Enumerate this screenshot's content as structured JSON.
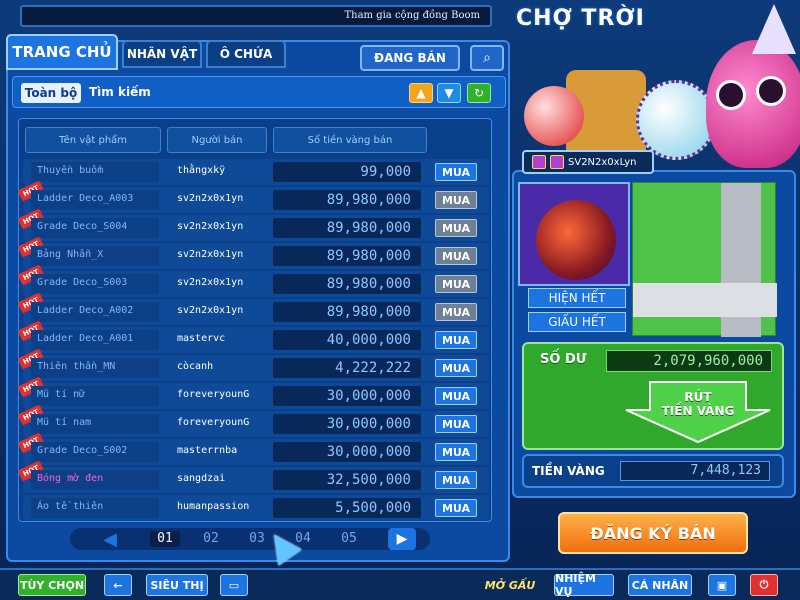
{
  "header": {
    "marquee": "Tham gia cộng đồng Boom",
    "title": "CHỢ TRỜI"
  },
  "tabs": [
    {
      "label": "TRANG CHỦ"
    },
    {
      "label": "NHÂN VẬT"
    },
    {
      "label": "Ô CHỨA"
    }
  ],
  "toolbar": {
    "selling_label": "ĐANG BÁN"
  },
  "filter": {
    "all_label": "Toàn bộ",
    "search_label": "Tìm kiếm"
  },
  "table": {
    "headers": [
      "Tên vật phẩm",
      "Người bán",
      "Số tiền vàng bán"
    ],
    "buy_label": "MUA",
    "hot_label": "HOT",
    "rows": [
      {
        "name": "Thuyền buồm",
        "seller": "thằngxkỹ",
        "price": "99,000",
        "hot": false,
        "pink": false,
        "dim": false
      },
      {
        "name": "Ladder Deco_A003",
        "seller": "sv2n2x0x1yn",
        "price": "89,980,000",
        "hot": true,
        "pink": false,
        "dim": true
      },
      {
        "name": "Grade Deco_S004",
        "seller": "sv2n2x0x1yn",
        "price": "89,980,000",
        "hot": true,
        "pink": false,
        "dim": true
      },
      {
        "name": "Bảng Nhẫn_X",
        "seller": "sv2n2x0x1yn",
        "price": "89,980,000",
        "hot": true,
        "pink": false,
        "dim": true
      },
      {
        "name": "Grade Deco_S003",
        "seller": "sv2n2x0x1yn",
        "price": "89,980,000",
        "hot": true,
        "pink": false,
        "dim": true
      },
      {
        "name": "Ladder Deco_A002",
        "seller": "sv2n2x0x1yn",
        "price": "89,980,000",
        "hot": true,
        "pink": false,
        "dim": true
      },
      {
        "name": "Ladder Deco_A001",
        "seller": "mastervc",
        "price": "40,000,000",
        "hot": true,
        "pink": false,
        "dim": false
      },
      {
        "name": "Thiên thần_MN",
        "seller": "còcanh",
        "price": "4,222,222",
        "hot": true,
        "pink": false,
        "dim": false
      },
      {
        "name": "Mũ tí nữ",
        "seller": "foreveryounG",
        "price": "30,000,000",
        "hot": true,
        "pink": false,
        "dim": false
      },
      {
        "name": "Mũ tí nam",
        "seller": "foreveryounG",
        "price": "30,000,000",
        "hot": true,
        "pink": false,
        "dim": false
      },
      {
        "name": "Grade Deco_S002",
        "seller": "masterrnba",
        "price": "30,000,000",
        "hot": true,
        "pink": false,
        "dim": false
      },
      {
        "name": "Bóng mờ đen",
        "seller": "sangdzai",
        "price": "32,500,000",
        "hot": true,
        "pink": true,
        "dim": false
      },
      {
        "name": "Áo tề thiên",
        "seller": "humanpassion",
        "price": "5,500,000",
        "hot": false,
        "pink": false,
        "dim": false
      }
    ]
  },
  "pager": {
    "pages": [
      "01",
      "02",
      "03",
      "04",
      "05"
    ],
    "active": "01"
  },
  "profile": {
    "name": "SV2N2x0xLyn",
    "show_all": "HIỆN HẾT",
    "hide_all": "GIẤU HẾT",
    "balance_label": "SỐ DƯ",
    "balance": "2,079,960,000",
    "withdraw_label_1": "RÚT",
    "withdraw_label_2": "TIỀN VÀNG",
    "gold_label": "TIỀN VÀNG",
    "gold": "7,448,123",
    "register_label": "ĐĂNG KÝ BÁN"
  },
  "bottombar": {
    "options": "TÙY CHỌN",
    "back_icon": "←",
    "shop": "SIÊU THỊ",
    "car_icon": "▭",
    "openbag": "MỞ GẤU",
    "mission": "NHIỆM VỤ",
    "profile": "CÁ NHÂN",
    "save_icon": "▣",
    "power_icon": "⏻"
  },
  "colors": {
    "accent": "#1b74e0",
    "hot": "#e03030",
    "register": "#f06e0e",
    "balance_bg": "#2fa82c"
  }
}
